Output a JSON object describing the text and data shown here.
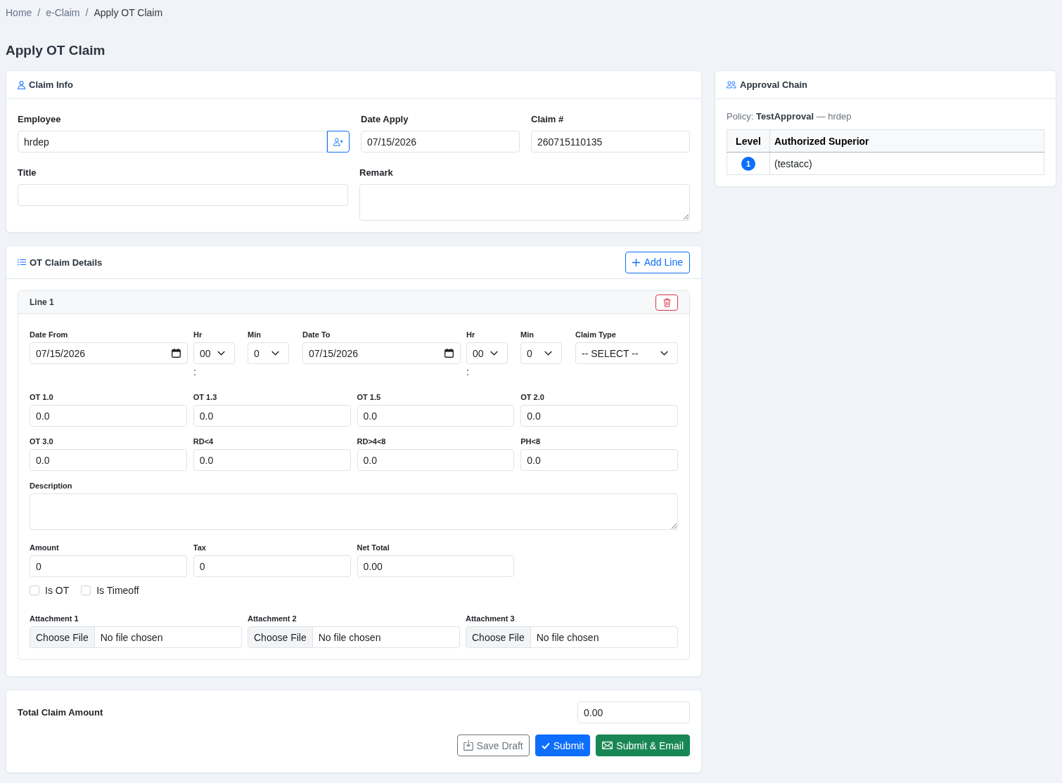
{
  "breadcrumb": [
    {
      "kind": "link",
      "label": "Home"
    },
    {
      "kind": "separator",
      "label": "/"
    },
    {
      "kind": "link",
      "label": "e-Claim"
    },
    {
      "kind": "separator",
      "label": "/"
    },
    {
      "kind": "current",
      "label": "Apply OT Claim"
    }
  ],
  "page_title": "Apply OT Claim",
  "claim_info": {
    "title": "Claim Info",
    "rows": [
      [
        {
          "kind": "lookup",
          "label": "Employee",
          "value": "hrdep"
        },
        {
          "kind": "text",
          "label": "Date Apply",
          "value": "07/15/2026"
        },
        {
          "kind": "text",
          "label": "Claim #",
          "value": "260715110135"
        }
      ],
      [
        {
          "kind": "text",
          "label": "Title"
        },
        {
          "kind": "textarea",
          "label": "Remark"
        }
      ]
    ]
  },
  "approval_chain": {
    "title": "Approval Chain",
    "policy": "Policy: **TestApproval** — hrdep",
    "columns": [
      "Level",
      "Authorized Superior"
    ],
    "rows": [
      {
        "level": "1",
        "superior": "(testacc)"
      }
    ]
  },
  "ot_claim_details": {
    "title": "OT Claim Details",
    "add_button": "Add Line",
    "lines": [
      {
        "title": "Line 1",
        "schedule": [
          {
            "kind": "date",
            "label": "Date From",
            "value": "07/15/2026"
          },
          {
            "kind": "select",
            "label": "Hr",
            "value": "00",
            "separator": ":"
          },
          {
            "kind": "select",
            "label": "Min",
            "value": "0"
          },
          {
            "kind": "date",
            "label": "Date To",
            "value": "07/15/2026"
          },
          {
            "kind": "select",
            "label": "Hr",
            "value": "00",
            "separator": ":"
          },
          {
            "kind": "select",
            "label": "Min",
            "value": "0"
          },
          {
            "kind": "select",
            "label": "Claim Type",
            "value": "-- SELECT --"
          }
        ],
        "rates": [
          {
            "label": "OT 1.0",
            "value": "0.0"
          },
          {
            "label": "OT 1.3",
            "value": "0.0"
          },
          {
            "label": "OT 1.5",
            "value": "0.0"
          },
          {
            "label": "OT 2.0",
            "value": "0.0"
          },
          {
            "label": "OT 3.0",
            "value": "0.0"
          },
          {
            "label": "RD<4",
            "value": "0.0"
          },
          {
            "label": "RD>4<8",
            "value": "0.0"
          },
          {
            "label": "PH<8",
            "value": "0.0"
          }
        ],
        "description": {
          "label": "Description"
        },
        "amounts": [
          {
            "label": "Amount",
            "value": "0"
          },
          {
            "label": "Tax",
            "value": "0"
          },
          {
            "label": "Net Total",
            "value": "0.00"
          }
        ],
        "checks": [
          {
            "label": "Is OT",
            "checked": false
          },
          {
            "label": "Is Timeoff",
            "checked": false
          }
        ],
        "attachments": [
          {
            "label": "Attachment 1",
            "button": "Choose File",
            "status": "No file chosen"
          },
          {
            "label": "Attachment 2",
            "button": "Choose File",
            "status": "No file chosen"
          },
          {
            "label": "Attachment 3",
            "button": "Choose File",
            "status": "No file chosen"
          }
        ]
      }
    ]
  },
  "total": {
    "label": "Total Claim Amount",
    "value": "0.00"
  },
  "actions": [
    {
      "kind": "outline",
      "label": "Save Draft"
    },
    {
      "kind": "primary",
      "label": "Submit"
    },
    {
      "kind": "success",
      "label": "Submit & Email"
    }
  ]
}
